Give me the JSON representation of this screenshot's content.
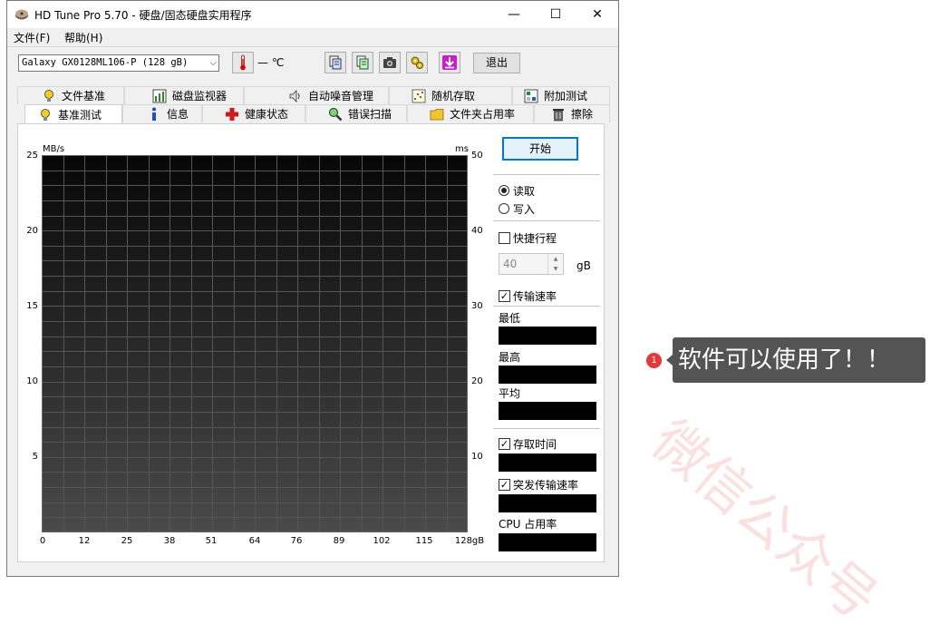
{
  "window": {
    "title": "HD Tune Pro 5.70 - 硬盘/固态硬盘实用程序",
    "minimize": "—",
    "maximize": "☐",
    "close": "✕"
  },
  "menu": {
    "file": "文件(F)",
    "help": "帮助(H)"
  },
  "toolbar": {
    "drive": "Galaxy GX0128ML106-P (128 gB)",
    "temperature": "— ℃",
    "exit": "退出"
  },
  "tabs": {
    "row1": [
      "文件基准",
      "磁盘监视器",
      "自动噪音管理",
      "随机存取",
      "附加测试"
    ],
    "row2": [
      "基准测试",
      "信息",
      "健康状态",
      "错误扫描",
      "文件夹占用率",
      "擦除"
    ]
  },
  "graph": {
    "left_unit": "MB/s",
    "right_unit": "ms",
    "left_ticks": [
      "25",
      "20",
      "15",
      "10",
      "5"
    ],
    "right_ticks": [
      "50",
      "40",
      "30",
      "20",
      "10"
    ],
    "x_ticks": [
      "0",
      "12",
      "25",
      "38",
      "51",
      "64",
      "76",
      "89",
      "102",
      "115",
      "128gB"
    ]
  },
  "controls": {
    "start": "开始",
    "read": "读取",
    "write": "写入",
    "short_stroke": "快捷行程",
    "short_stroke_value": "40",
    "short_stroke_unit": "gB",
    "transfer_rate": "传输速率",
    "minimum": "最低",
    "maximum": "最高",
    "average": "平均",
    "access_time": "存取时间",
    "burst_rate": "突发传输速率",
    "cpu_usage": "CPU 占用率"
  },
  "annotation": {
    "badge": "1",
    "text": "软件可以使用了！！"
  },
  "watermark": "微信公众号"
}
